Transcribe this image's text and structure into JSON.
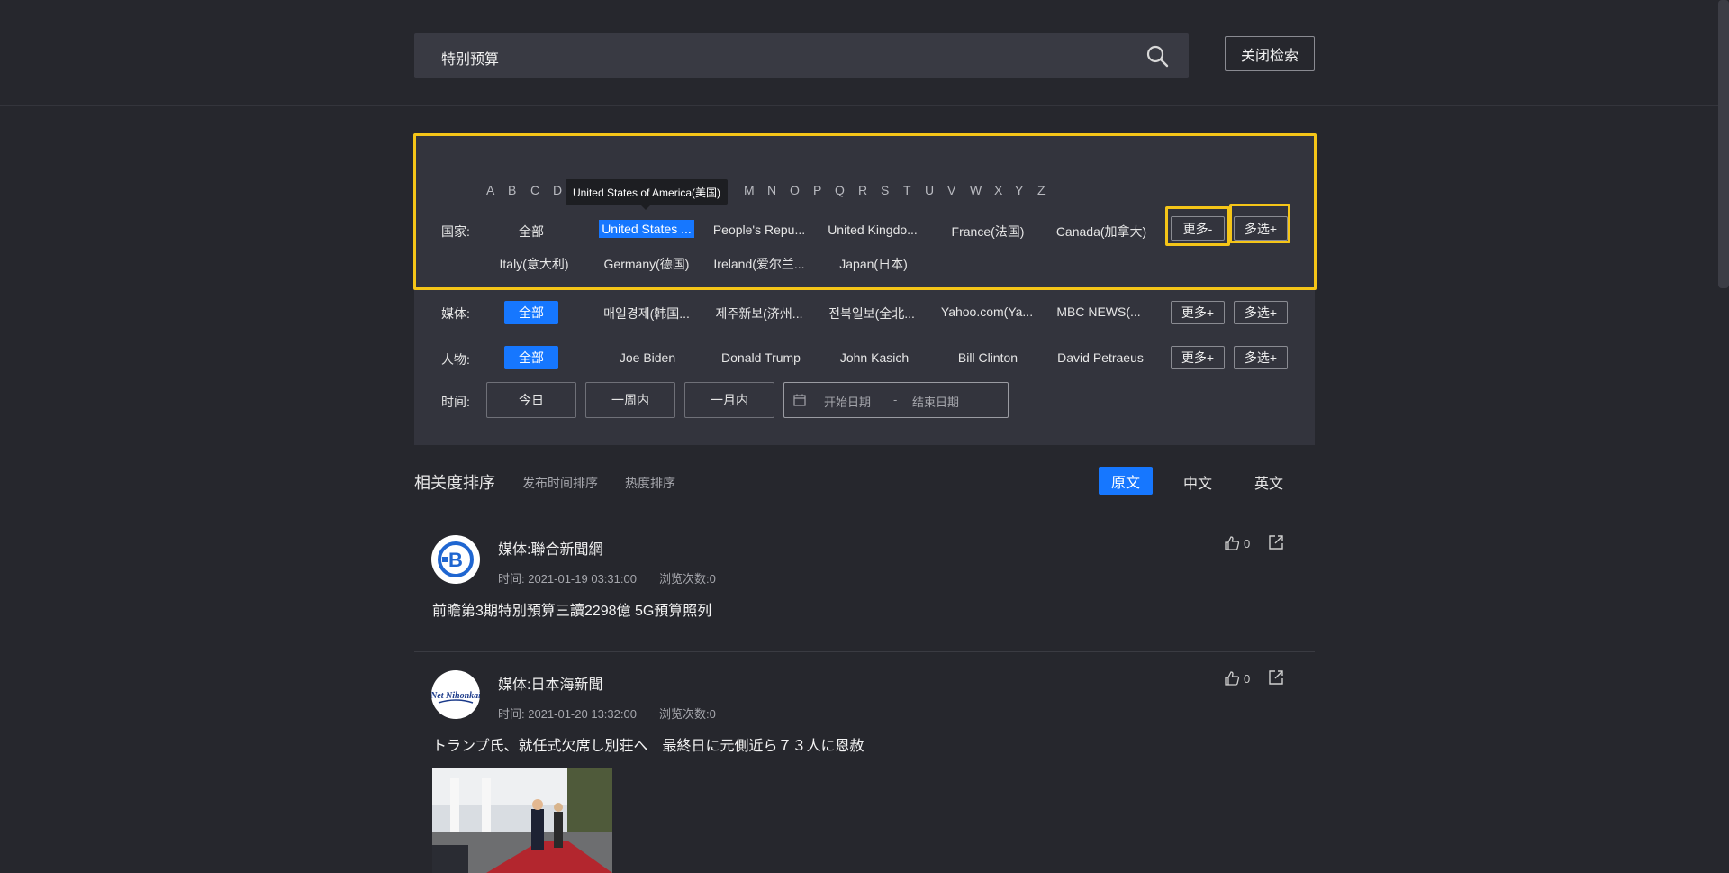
{
  "search": {
    "query": "特别预算",
    "close_label": "关闭检索"
  },
  "country_filter": {
    "letters": [
      "A",
      "B",
      "C",
      "D",
      "M",
      "N",
      "O",
      "P",
      "Q",
      "R",
      "S",
      "T",
      "U",
      "V",
      "W",
      "X",
      "Y",
      "Z"
    ],
    "tooltip": "United States of America(美国)",
    "label": "国家:",
    "row1": [
      "全部",
      "United States ...",
      "People's Repu...",
      "United Kingdo...",
      "France(法国)",
      "Canada(加拿大)"
    ],
    "row2": [
      "Italy(意大利)",
      "Germany(德国)",
      "Ireland(爱尔兰...",
      "Japan(日本)"
    ],
    "more_label": "更多-",
    "multi_label": "多选+"
  },
  "media_filter": {
    "label": "媒体:",
    "all_label": "全部",
    "items": [
      "매일경제(韩国...",
      "제주新보(济州...",
      "전북일보(全北...",
      "Yahoo.com(Ya...",
      "MBC NEWS(..."
    ],
    "more_label": "更多+",
    "multi_label": "多选+"
  },
  "person_filter": {
    "label": "人物:",
    "all_label": "全部",
    "items": [
      "Joe Biden",
      "Donald Trump",
      "John Kasich",
      "Bill Clinton",
      "David Petraeus"
    ],
    "more_label": "更多+",
    "multi_label": "多选+"
  },
  "time_filter": {
    "label": "时间:",
    "buttons": [
      "今日",
      "一周内",
      "一月内"
    ],
    "start_placeholder": "开始日期",
    "separator": "-",
    "end_placeholder": "结束日期"
  },
  "sort": {
    "active": "相关度排序",
    "options": [
      "发布时间排序",
      "热度排序"
    ],
    "languages": [
      "原文",
      "中文",
      "英文"
    ]
  },
  "results": [
    {
      "media": "媒体:聯合新聞網",
      "time": "时间: 2021-01-19 03:31:00",
      "views": "浏览次数:0",
      "likes": "0",
      "title": "前瞻第3期特別預算三讀2298億 5G預算照列"
    },
    {
      "media": "媒体:日本海新聞",
      "time": "时间: 2021-01-20 13:32:00",
      "views": "浏览次数:0",
      "likes": "0",
      "title": "トランプ氏、就任式欠席し別荘へ　最終日に元側近ら７３人に恩赦",
      "logo_text": "Net Nihonkai"
    }
  ],
  "colors": {
    "accent": "#1677ff",
    "highlight": "#f5c518",
    "background": "#26272d",
    "panel": "#33343d"
  }
}
